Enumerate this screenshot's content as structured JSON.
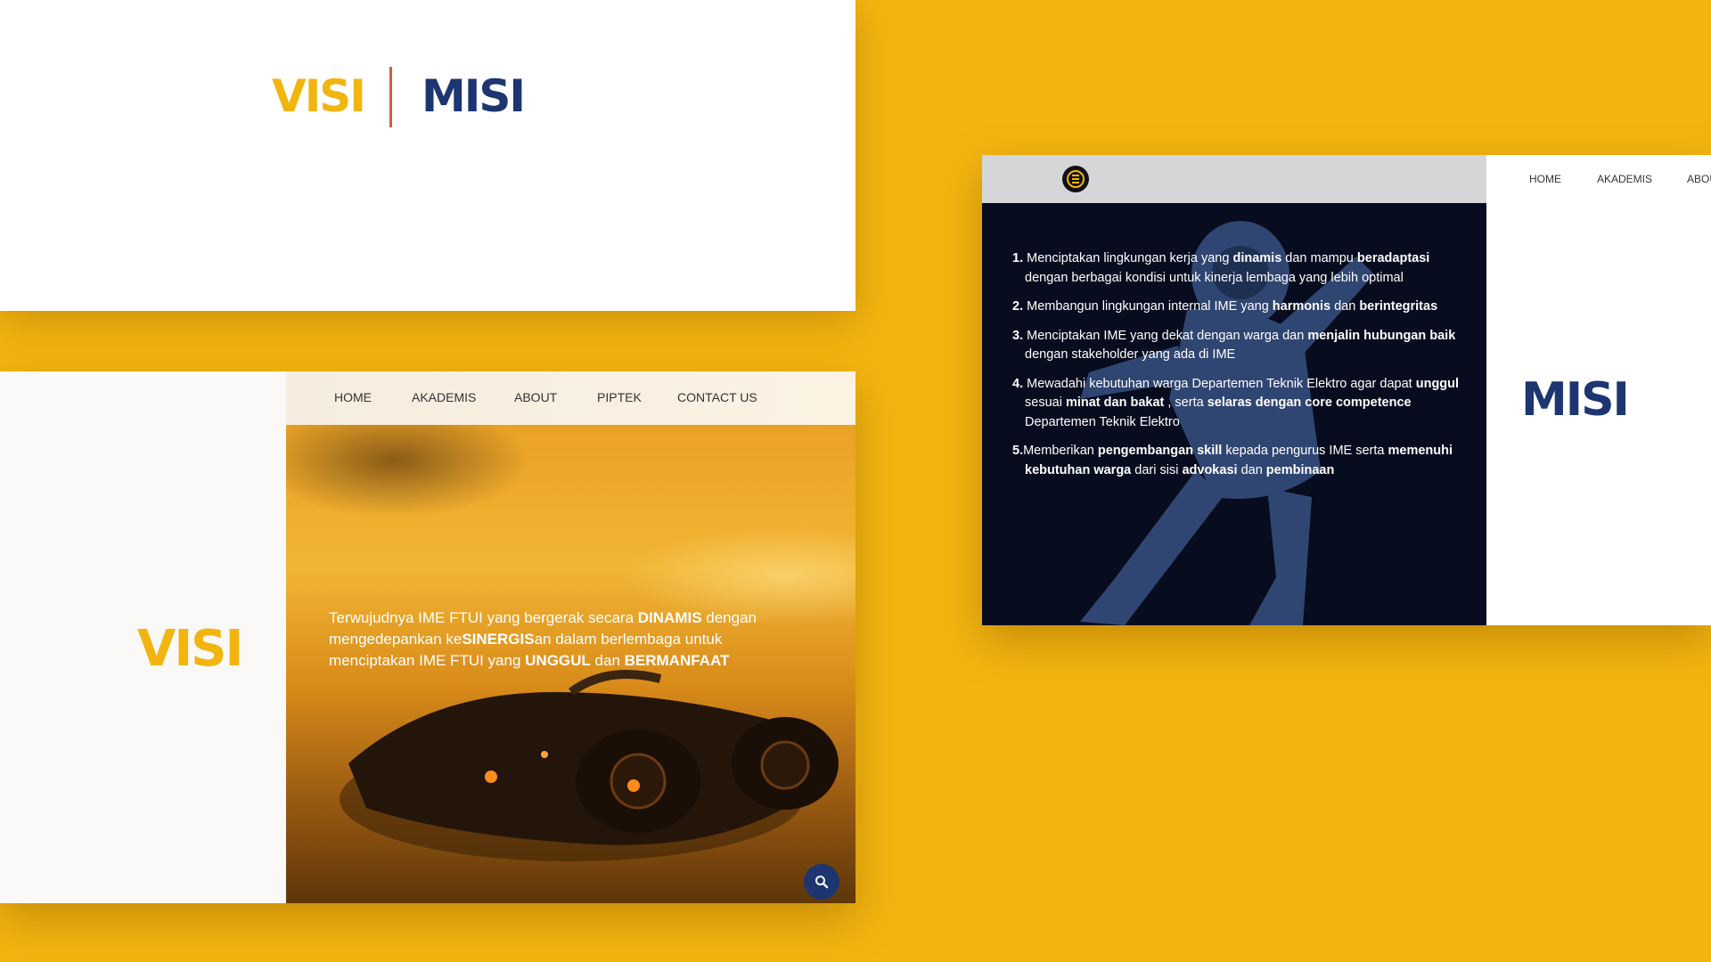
{
  "colors": {
    "background": "#F2B50F",
    "visi": "#F2B50F",
    "misi": "#1D3570",
    "divider": "#D0603A"
  },
  "title_card": {
    "visi": "VISI",
    "misi": "MISI"
  },
  "visi_page": {
    "nav": [
      "HOME",
      "AKADEMIS",
      "ABOUT",
      "PIPTEK",
      "CONTACT US"
    ],
    "heading": "VISI",
    "statement": {
      "p1": "Terwujudnya IME FTUI yang bergerak secara ",
      "b1": "DINAMIS",
      "p2": " dengan mengedepankan ke",
      "b2": "SINERGIS",
      "p3": "an dalam berlembaga untuk menciptakan IME FTUI yang ",
      "b3": "UNGGUL",
      "p4": " dan ",
      "b4": "BERMANFAAT"
    },
    "search_icon": "search-icon"
  },
  "misi_page": {
    "nav": [
      "HOME",
      "AKADEMIS",
      "ABOU"
    ],
    "heading": "MISI",
    "logo_icon": "ime-logo",
    "items": [
      {
        "num": "1.",
        "t1": " Menciptakan lingkungan kerja yang ",
        "b1": "dinamis",
        "t2": " dan mampu ",
        "b2": "beradaptasi",
        "t3": " dengan berbagai kondisi untuk kinerja lembaga yang lebih optimal"
      },
      {
        "num": "2.",
        "t1": " Membangun lingkungan internal IME yang ",
        "b1": "harmonis",
        "t2": " dan ",
        "b2": "berintegritas",
        "t3": ""
      },
      {
        "num": "3.",
        "t1": " Menciptakan IME yang dekat dengan warga dan ",
        "b1": "menjalin hubungan baik",
        "t2": " dengan stakeholder yang ada di IME",
        "b2": "",
        "t3": ""
      },
      {
        "num": "4.",
        "t1": " Mewadahi kebutuhan warga Departemen Teknik Elektro agar dapat ",
        "b1": "unggul",
        "t2": " sesuai ",
        "b2": "minat dan bakat",
        "t3": " , serta ",
        "b3": "selaras dengan core competence",
        "t4": " Departemen Teknik Elektro"
      },
      {
        "num": "5.",
        "t1": "Memberikan ",
        "b1": "pengembangan skill",
        "t2": " kepada pengurus IME serta ",
        "b2": "memenuhi kebutuhan warga",
        "t3": " dari sisi ",
        "b3": "advokasi",
        "t4": " dan ",
        "b4": "pembinaan"
      }
    ]
  }
}
